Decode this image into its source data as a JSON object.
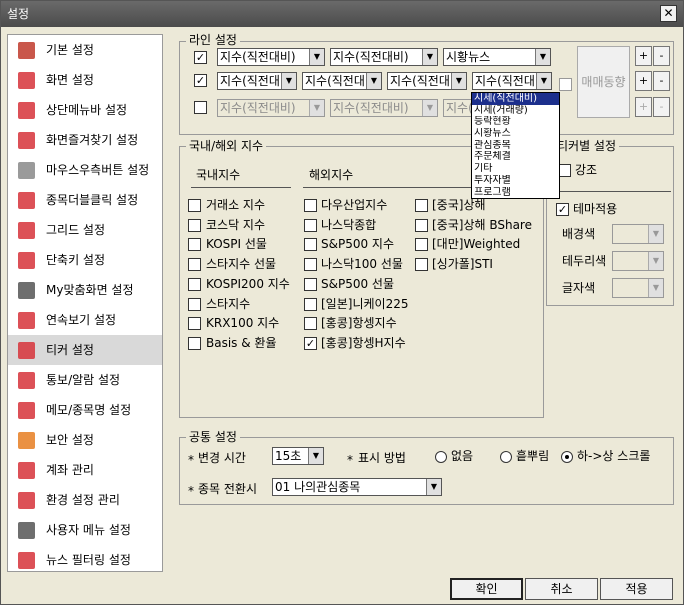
{
  "window": {
    "title": "설정",
    "close": "✕"
  },
  "sidebar": {
    "items": [
      {
        "label": "기본 설정",
        "icon": "settings-icon",
        "color": "#c0392b"
      },
      {
        "label": "화면 설정",
        "icon": "screen-icon",
        "color": "#d6333a"
      },
      {
        "label": "상단메뉴바 설정",
        "icon": "menubar-icon",
        "color": "#d6333a"
      },
      {
        "label": "화면즐겨찾기 설정",
        "icon": "star-icon",
        "color": "#d6333a"
      },
      {
        "label": "마우스우측버튼 설정",
        "icon": "mouse-icon",
        "color": "#888888"
      },
      {
        "label": "종목더블클릭 설정",
        "icon": "cursor-icon",
        "color": "#d6333a"
      },
      {
        "label": "그리드 설정",
        "icon": "grid-icon",
        "color": "#d6333a"
      },
      {
        "label": "단축키 설정",
        "icon": "keyboard-icon",
        "color": "#d6333a"
      },
      {
        "label": "My맞춤화면 설정",
        "icon": "monitor-icon",
        "color": "#555555"
      },
      {
        "label": "연속보기 설정",
        "icon": "search-icon",
        "color": "#d6333a"
      },
      {
        "label": "티커 설정",
        "icon": "ticker-icon",
        "color": "#d6333a"
      },
      {
        "label": "통보/알람 설정",
        "icon": "alarm-icon",
        "color": "#d6333a"
      },
      {
        "label": "메모/종목명 설정",
        "icon": "memo-icon",
        "color": "#d6333a"
      },
      {
        "label": "보안 설정",
        "icon": "shield-icon",
        "color": "#e67e22"
      },
      {
        "label": "계좌 관리",
        "icon": "account-icon",
        "color": "#d6333a"
      },
      {
        "label": "환경 설정 관리",
        "icon": "gear-icon",
        "color": "#d6333a"
      },
      {
        "label": "사용자 메뉴 설정",
        "icon": "user-menu-icon",
        "color": "#555555"
      },
      {
        "label": "뉴스 필터링 설정",
        "icon": "news-icon",
        "color": "#d6333a"
      }
    ],
    "selected": 10
  },
  "line": {
    "title": "라인 설정",
    "rows": [
      {
        "checked": "✓",
        "combos": [
          "지수(직전대비)",
          "지수(직전대비)",
          "시황뉴스"
        ]
      },
      {
        "checked": "✓",
        "combos": [
          "지수(직전대",
          "지수(직전대",
          "지수(직전대",
          "지수(직전대"
        ]
      },
      {
        "checked": "",
        "combos": [
          "지수(직전대비)",
          "지수(직전대비)",
          "지수(직전대"
        ]
      }
    ],
    "trade_label": "매매동향",
    "plus": "+",
    "minus": "-"
  },
  "dropdown": {
    "items": [
      "시세(직전대비)",
      "시세(거래량)",
      "등락현황",
      "시황뉴스",
      "관심종목",
      "주문체결",
      "기타",
      "투자자별",
      "프로그램"
    ],
    "selected": 0
  },
  "index": {
    "title": "국내/해외 지수",
    "domestic_header": "국내지수",
    "overseas_header": "해외지수",
    "domestic": [
      {
        "label": "거래소 지수",
        "c": ""
      },
      {
        "label": "코스닥 지수",
        "c": ""
      },
      {
        "label": "KOSPI 선물",
        "c": ""
      },
      {
        "label": "스타지수 선물",
        "c": ""
      },
      {
        "label": "KOSPI200 지수",
        "c": ""
      },
      {
        "label": "스타지수",
        "c": ""
      },
      {
        "label": "KRX100 지수",
        "c": ""
      },
      {
        "label": "Basis & 환율",
        "c": ""
      }
    ],
    "overseas1": [
      {
        "label": "다우산업지수",
        "c": ""
      },
      {
        "label": "나스닥종합",
        "c": ""
      },
      {
        "label": "S&P500 지수",
        "c": ""
      },
      {
        "label": "나스닥100 선물",
        "c": ""
      },
      {
        "label": "S&P500 선물",
        "c": ""
      },
      {
        "label": "[일본]니케이225",
        "c": ""
      },
      {
        "label": "[홍콩]항셍지수",
        "c": ""
      },
      {
        "label": "[홍콩]항셍H지수",
        "c": "✓"
      }
    ],
    "overseas2": [
      {
        "label": "[중국]상해",
        "c": ""
      },
      {
        "label": "[중국]상해 BShare",
        "c": ""
      },
      {
        "label": "[대만]Weighted",
        "c": ""
      },
      {
        "label": "[싱가폴]STI",
        "c": ""
      }
    ]
  },
  "ticker": {
    "title": "티커별 설정",
    "emphasis": "강조",
    "theme": "테마적용",
    "theme_checked": "✓",
    "bg": "배경색",
    "border": "테두리색",
    "font": "글자색"
  },
  "common": {
    "title": "공통 설정",
    "star": "*",
    "change_time_label": "변경 시간",
    "change_time_value": "15초",
    "display_label": "표시 방법",
    "opt_none": "없음",
    "opt_sprinkle": "흩뿌림",
    "opt_scroll": "하->상 스크롤",
    "switch_label": "종목 전환시",
    "switch_value": "01 나의관심종목"
  },
  "buttons": {
    "ok": "확인",
    "cancel": "취소",
    "apply": "적용"
  }
}
